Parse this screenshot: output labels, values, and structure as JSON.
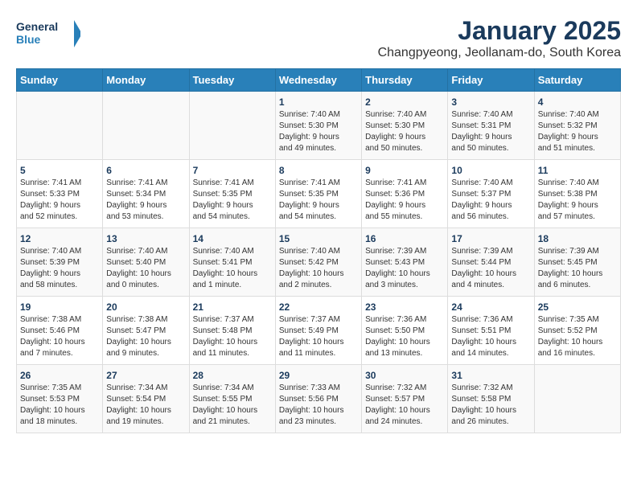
{
  "header": {
    "logo_line1": "General",
    "logo_line2": "Blue",
    "title": "January 2025",
    "subtitle": "Changpyeong, Jeollanam-do, South Korea"
  },
  "days_of_week": [
    "Sunday",
    "Monday",
    "Tuesday",
    "Wednesday",
    "Thursday",
    "Friday",
    "Saturday"
  ],
  "weeks": [
    [
      {
        "day": "",
        "info": ""
      },
      {
        "day": "",
        "info": ""
      },
      {
        "day": "",
        "info": ""
      },
      {
        "day": "1",
        "info": "Sunrise: 7:40 AM\nSunset: 5:30 PM\nDaylight: 9 hours\nand 49 minutes."
      },
      {
        "day": "2",
        "info": "Sunrise: 7:40 AM\nSunset: 5:30 PM\nDaylight: 9 hours\nand 50 minutes."
      },
      {
        "day": "3",
        "info": "Sunrise: 7:40 AM\nSunset: 5:31 PM\nDaylight: 9 hours\nand 50 minutes."
      },
      {
        "day": "4",
        "info": "Sunrise: 7:40 AM\nSunset: 5:32 PM\nDaylight: 9 hours\nand 51 minutes."
      }
    ],
    [
      {
        "day": "5",
        "info": "Sunrise: 7:41 AM\nSunset: 5:33 PM\nDaylight: 9 hours\nand 52 minutes."
      },
      {
        "day": "6",
        "info": "Sunrise: 7:41 AM\nSunset: 5:34 PM\nDaylight: 9 hours\nand 53 minutes."
      },
      {
        "day": "7",
        "info": "Sunrise: 7:41 AM\nSunset: 5:35 PM\nDaylight: 9 hours\nand 54 minutes."
      },
      {
        "day": "8",
        "info": "Sunrise: 7:41 AM\nSunset: 5:35 PM\nDaylight: 9 hours\nand 54 minutes."
      },
      {
        "day": "9",
        "info": "Sunrise: 7:41 AM\nSunset: 5:36 PM\nDaylight: 9 hours\nand 55 minutes."
      },
      {
        "day": "10",
        "info": "Sunrise: 7:40 AM\nSunset: 5:37 PM\nDaylight: 9 hours\nand 56 minutes."
      },
      {
        "day": "11",
        "info": "Sunrise: 7:40 AM\nSunset: 5:38 PM\nDaylight: 9 hours\nand 57 minutes."
      }
    ],
    [
      {
        "day": "12",
        "info": "Sunrise: 7:40 AM\nSunset: 5:39 PM\nDaylight: 9 hours\nand 58 minutes."
      },
      {
        "day": "13",
        "info": "Sunrise: 7:40 AM\nSunset: 5:40 PM\nDaylight: 10 hours\nand 0 minutes."
      },
      {
        "day": "14",
        "info": "Sunrise: 7:40 AM\nSunset: 5:41 PM\nDaylight: 10 hours\nand 1 minute."
      },
      {
        "day": "15",
        "info": "Sunrise: 7:40 AM\nSunset: 5:42 PM\nDaylight: 10 hours\nand 2 minutes."
      },
      {
        "day": "16",
        "info": "Sunrise: 7:39 AM\nSunset: 5:43 PM\nDaylight: 10 hours\nand 3 minutes."
      },
      {
        "day": "17",
        "info": "Sunrise: 7:39 AM\nSunset: 5:44 PM\nDaylight: 10 hours\nand 4 minutes."
      },
      {
        "day": "18",
        "info": "Sunrise: 7:39 AM\nSunset: 5:45 PM\nDaylight: 10 hours\nand 6 minutes."
      }
    ],
    [
      {
        "day": "19",
        "info": "Sunrise: 7:38 AM\nSunset: 5:46 PM\nDaylight: 10 hours\nand 7 minutes."
      },
      {
        "day": "20",
        "info": "Sunrise: 7:38 AM\nSunset: 5:47 PM\nDaylight: 10 hours\nand 9 minutes."
      },
      {
        "day": "21",
        "info": "Sunrise: 7:37 AM\nSunset: 5:48 PM\nDaylight: 10 hours\nand 11 minutes."
      },
      {
        "day": "22",
        "info": "Sunrise: 7:37 AM\nSunset: 5:49 PM\nDaylight: 10 hours\nand 11 minutes."
      },
      {
        "day": "23",
        "info": "Sunrise: 7:36 AM\nSunset: 5:50 PM\nDaylight: 10 hours\nand 13 minutes."
      },
      {
        "day": "24",
        "info": "Sunrise: 7:36 AM\nSunset: 5:51 PM\nDaylight: 10 hours\nand 14 minutes."
      },
      {
        "day": "25",
        "info": "Sunrise: 7:35 AM\nSunset: 5:52 PM\nDaylight: 10 hours\nand 16 minutes."
      }
    ],
    [
      {
        "day": "26",
        "info": "Sunrise: 7:35 AM\nSunset: 5:53 PM\nDaylight: 10 hours\nand 18 minutes."
      },
      {
        "day": "27",
        "info": "Sunrise: 7:34 AM\nSunset: 5:54 PM\nDaylight: 10 hours\nand 19 minutes."
      },
      {
        "day": "28",
        "info": "Sunrise: 7:34 AM\nSunset: 5:55 PM\nDaylight: 10 hours\nand 21 minutes."
      },
      {
        "day": "29",
        "info": "Sunrise: 7:33 AM\nSunset: 5:56 PM\nDaylight: 10 hours\nand 23 minutes."
      },
      {
        "day": "30",
        "info": "Sunrise: 7:32 AM\nSunset: 5:57 PM\nDaylight: 10 hours\nand 24 minutes."
      },
      {
        "day": "31",
        "info": "Sunrise: 7:32 AM\nSunset: 5:58 PM\nDaylight: 10 hours\nand 26 minutes."
      },
      {
        "day": "",
        "info": ""
      }
    ]
  ]
}
